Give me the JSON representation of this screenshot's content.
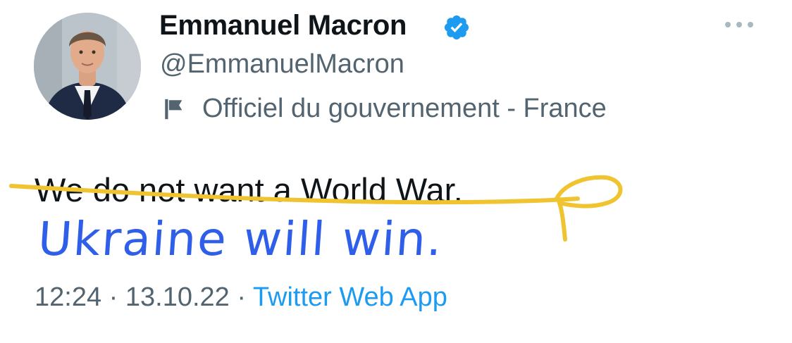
{
  "user": {
    "display_name": "Emmanuel Macron",
    "handle": "@EmmanuelMacron",
    "label": "Officiel du gouvernement - France",
    "verified_color": "#1d9bf0"
  },
  "tweet": {
    "text": "We do not want a World War.",
    "time": "12:24",
    "separator": "·",
    "date": "13.10.22",
    "source": "Twitter Web App"
  },
  "annotation": {
    "handwritten_text": "Ukraine will win.",
    "strike_color": "#f0c430",
    "handwriting_color": "#2f5fe8"
  },
  "icons": {
    "more": "more-icon",
    "flag": "flag-icon",
    "verified": "verified-badge-icon"
  }
}
